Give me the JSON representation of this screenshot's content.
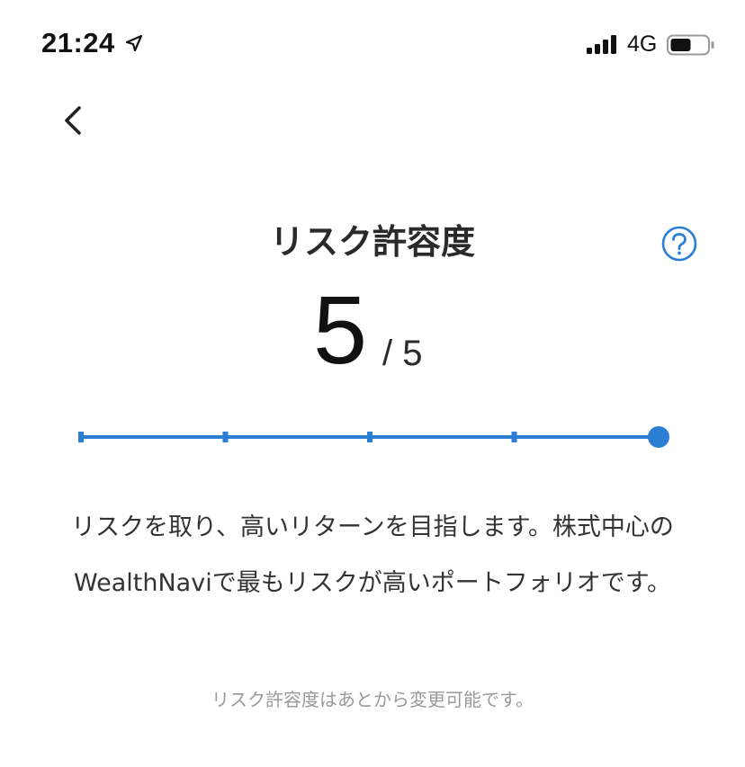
{
  "status_bar": {
    "time": "21:24",
    "network": "4G",
    "icons": [
      "location-arrow-icon",
      "signal-bars-icon",
      "battery-icon"
    ]
  },
  "nav": {
    "back_icon": "chevron-left-icon"
  },
  "header": {
    "title": "リスク許容度",
    "help_icon": "question-circle-icon"
  },
  "score": {
    "value": "5",
    "max": "/ 5"
  },
  "slider": {
    "min": 1,
    "max": 5,
    "current": 5,
    "steps": 5
  },
  "description": {
    "text": "リスクを取り、高いリターンを目指します。株式中心のWealthNaviで最もリスクが高いポートフォリオです。"
  },
  "note": {
    "text": "リスク許容度はあとから変更可能です。"
  },
  "colors": {
    "accent": "#2a7fd4",
    "text_primary": "#1f1f1f",
    "text_muted": "#9a9a9a",
    "background": "#ffffff"
  }
}
